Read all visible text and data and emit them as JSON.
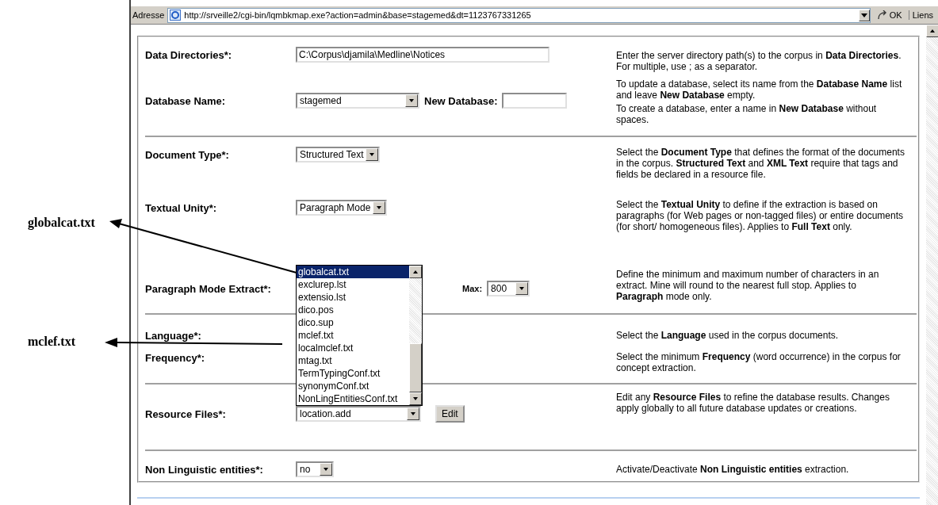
{
  "address_bar": {
    "label": "Adresse",
    "url": "http://srveille2/cgi-bin/lqmbkmap.exe?action=admin&base=stagemed&dt=1123767331265",
    "go": "OK",
    "links": "Liens"
  },
  "callouts": [
    {
      "text": "globalcat.txt"
    },
    {
      "text": "mclef.txt"
    }
  ],
  "sections": [
    {
      "rows": [
        {
          "kind": "text",
          "label": "Data Directories*:",
          "value": "C:\\Corpus\\djamila\\Medline\\Notices",
          "help": [
            "Enter the server directory path(s) to the corpus in **Data Directories**. For multiple, use ; as a separator."
          ]
        },
        {
          "kind": "select_new",
          "label": "Database Name:",
          "value": "stagemed",
          "extra_label": "New Database:",
          "help": [
            "To update a database, select its name from the **Database Name** list and leave **New Database** empty.",
            "To create a database, enter a name in **New Database** without spaces."
          ]
        }
      ]
    },
    {
      "rows": [
        {
          "kind": "select",
          "label": "Document Type*:",
          "value": "Structured Text",
          "help": [
            "Select the **Document Type** that defines the format of the documents in the corpus. **Structured Text** and **XML Text** require that tags and fields be declared in a resource file."
          ]
        },
        {
          "kind": "select",
          "label": "Textual Unity*:",
          "value": "Paragraph Mode",
          "help": [
            "Select the **Textual Unity** to define if the extraction is based on paragraphs (for Web pages or non-tagged files) or entire documents (for short/ homogeneous files). Applies to **Full Text** only."
          ]
        },
        {
          "kind": "minmax",
          "label": "Paragraph Mode Extract*:",
          "max_label": "Max:",
          "max_value": "800",
          "help": [
            "Define the minimum and maximum number of characters in an extract. Mine will round to the nearest full stop. Applies to **Paragraph** mode only."
          ]
        }
      ]
    },
    {
      "rows": [
        {
          "kind": "covered",
          "label": "Language*:",
          "help": [
            "Select the **Language** used in the corpus documents."
          ]
        },
        {
          "kind": "covered",
          "label": "Frequency*:",
          "help": [
            "Select the minimum **Frequency** (word occurrence) in the corpus for concept extraction."
          ]
        }
      ]
    },
    {
      "rows": [
        {
          "kind": "select_button",
          "label": "Resource Files*:",
          "value": "location.add",
          "button": "Edit",
          "open_list": [
            {
              "text": "globalcat.txt",
              "selected": true
            },
            {
              "text": "exclurep.lst",
              "selected": false
            },
            {
              "text": "extensio.lst",
              "selected": false
            },
            {
              "text": "dico.pos",
              "selected": false
            },
            {
              "text": "dico.sup",
              "selected": false
            },
            {
              "text": "mclef.txt",
              "selected": false
            },
            {
              "text": "localmclef.txt",
              "selected": false
            },
            {
              "text": "mtag.txt",
              "selected": false
            },
            {
              "text": "TermTypingConf.txt",
              "selected": false
            },
            {
              "text": "synonymConf.txt",
              "selected": false
            },
            {
              "text": "NonLingEntitiesConf.txt",
              "selected": false
            }
          ],
          "help": [
            "Edit any **Resource Files** to refine the database results. Changes apply globally to all future database updates or creations."
          ]
        }
      ]
    },
    {
      "rows": [
        {
          "kind": "select",
          "label": "Non Linguistic entities*:",
          "value": "no",
          "help": [
            "Activate/Deactivate **Non Linguistic entities** extraction."
          ]
        }
      ]
    }
  ]
}
